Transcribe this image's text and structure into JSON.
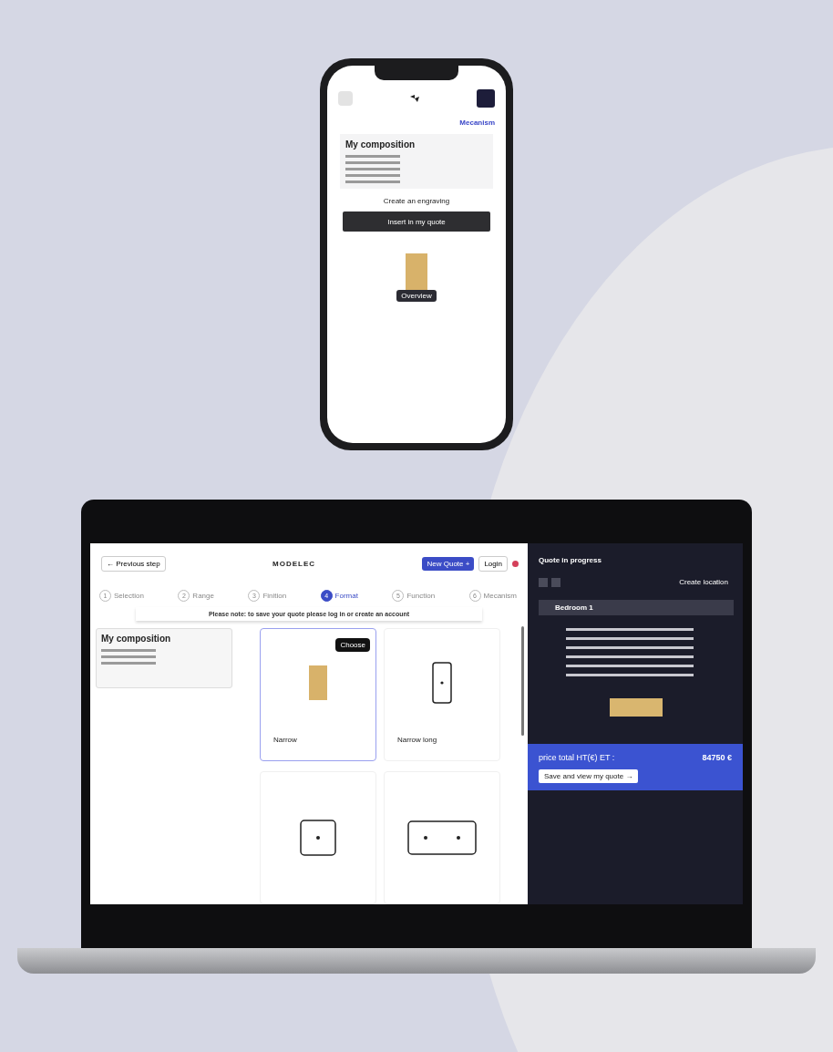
{
  "phone": {
    "steps": [
      {
        "label": "Mecanism",
        "selected": true
      }
    ],
    "composition_title": "My composition",
    "engrave_button": "Create an engraving",
    "insert_button": "Insert in my quote",
    "overview_button": "Overview"
  },
  "laptop": {
    "previous_button": "← Previous step",
    "brand": "MODELEC",
    "new_quote_button": "New Quote +",
    "login_button": "Login",
    "steps": [
      {
        "number": "1",
        "label": "Selection",
        "selected": false
      },
      {
        "number": "2",
        "label": "Range",
        "selected": false
      },
      {
        "number": "3",
        "label": "Finition",
        "selected": false
      },
      {
        "number": "4",
        "label": "Format",
        "selected": true
      },
      {
        "number": "5",
        "label": "Function",
        "selected": false
      },
      {
        "number": "6",
        "label": "Mecanism",
        "selected": false
      }
    ],
    "notice": "Please note: to save your quote please log in or create an account",
    "composition_title": "My composition",
    "choose_button": "Choose",
    "formats": [
      {
        "kind": "gold",
        "name": "Narrow",
        "selected": true
      },
      {
        "kind": "tall",
        "name": "Narrow long",
        "selected": false
      },
      {
        "kind": "square",
        "selected": false
      },
      {
        "kind": "double",
        "selected": false
      }
    ],
    "quote": {
      "title": "Quote in progress",
      "create_location": "Create location",
      "rooms": [
        {
          "name": "Bedroom 1"
        }
      ],
      "total_label": "price total HT(€) ET :",
      "total": "84750 €",
      "save_button": "Save and view my quote →"
    }
  }
}
